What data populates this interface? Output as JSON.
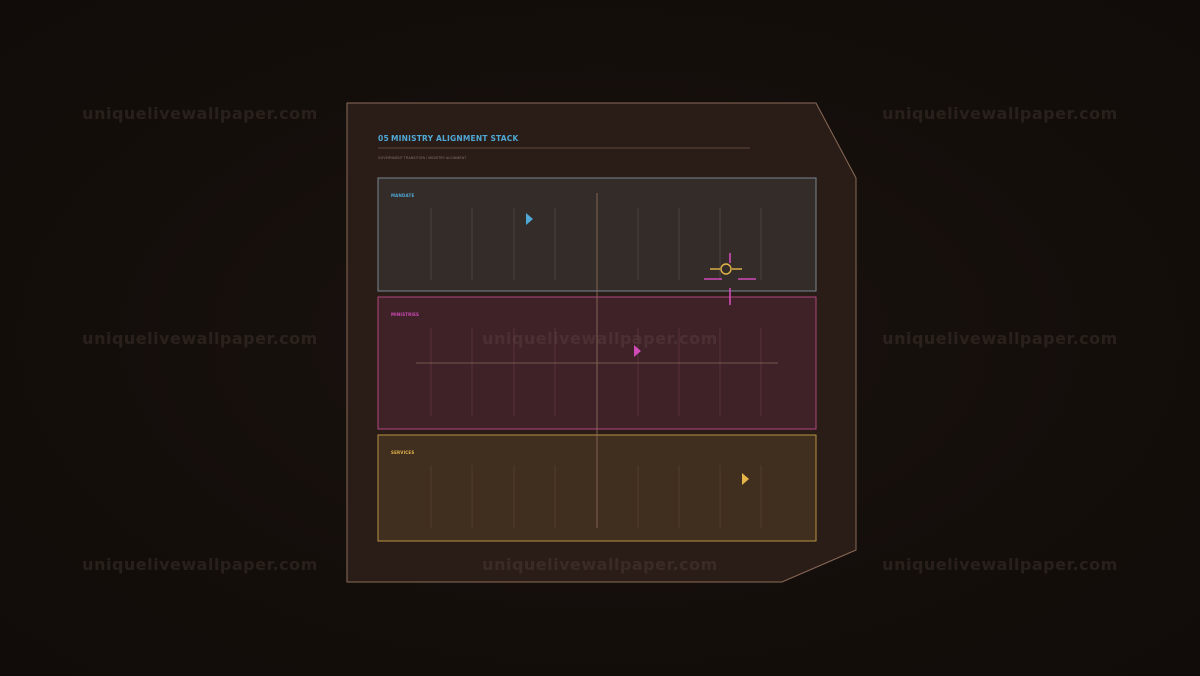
{
  "watermark": {
    "text": "uniquelivewallpaper.com"
  },
  "header": {
    "number": "05",
    "title": "MINISTRY ALIGNMENT STACK",
    "subtitle": "GOVERNMENT TRANSITION / MINISTRY ALIGNMENT"
  },
  "bands": {
    "mandate": {
      "label": "MANDATE"
    },
    "ministries": {
      "label": "MINISTRIES"
    },
    "services": {
      "label": "SERVICES"
    }
  },
  "colors": {
    "mandate": "#4fa8d6",
    "ministries": "#d04ab8",
    "services": "#e5b54a",
    "frame": "#8a6a58"
  },
  "icons": {
    "marker": "triangle-right-icon",
    "target": "crosshair-icon"
  }
}
